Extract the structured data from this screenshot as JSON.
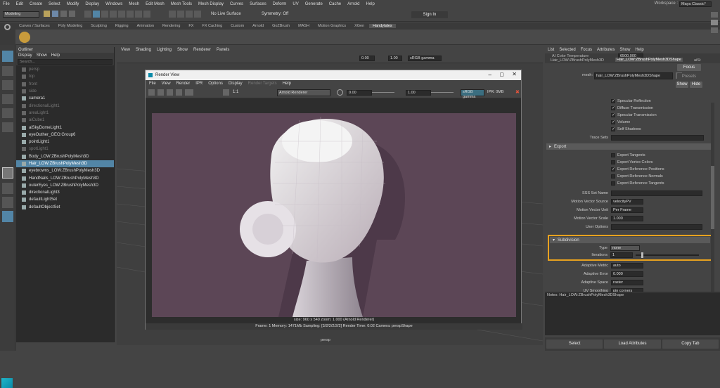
{
  "menubar": [
    "File",
    "Edit",
    "Create",
    "Select",
    "Modify",
    "Display",
    "Windows",
    "Mesh",
    "Edit Mesh",
    "Mesh Tools",
    "Mesh Display",
    "Curves",
    "Surfaces",
    "Deform",
    "UV",
    "Generate",
    "Cache",
    "Arnold",
    "Help"
  ],
  "workspace": {
    "label": "Workspace :",
    "value": "Maya Classic*"
  },
  "toolbar": {
    "mode": "Modeling",
    "live": "No Live Surface",
    "symmetry": "Symmetry: Off",
    "signin": "Sign In"
  },
  "shelf_tabs": [
    "Curves / Surfaces",
    "Poly Modeling",
    "Sculpting",
    "Rigging",
    "Animation",
    "Rendering",
    "FX",
    "FX Caching",
    "Custom",
    "Arnold",
    "GoZBrush",
    "MASH",
    "Motion Graphics",
    "XGen",
    "Handytales"
  ],
  "shelf_active": "Handytales",
  "outliner": {
    "title": "Outliner",
    "menu": [
      "Display",
      "Show",
      "Help"
    ],
    "search_placeholder": "Search...",
    "items": [
      {
        "label": "persp",
        "dim": true
      },
      {
        "label": "top",
        "dim": true
      },
      {
        "label": "front",
        "dim": true
      },
      {
        "label": "side",
        "dim": true
      },
      {
        "label": "camera1",
        "dim": false
      },
      {
        "label": "directionalLight1",
        "dim": true
      },
      {
        "label": "areaLight1",
        "dim": true
      },
      {
        "label": "aiCube1",
        "dim": true
      },
      {
        "label": "aiSkyDomeLight1",
        "dim": false
      },
      {
        "label": "eyeOuther_GEO:Group6",
        "dim": false
      },
      {
        "label": "pointLight1",
        "dim": false
      },
      {
        "label": "spotLight1",
        "dim": true
      },
      {
        "label": "Body_LOW:ZBrushPolyMesh3D",
        "dim": false
      },
      {
        "label": "Hair_LOW:ZBrushPolyMesh3D",
        "dim": false,
        "selected": true
      },
      {
        "label": "eyebrowns_LOW:ZBrushPolyMesh3D",
        "dim": false
      },
      {
        "label": "HandNails_LOW:ZBrushPolyMesh3D",
        "dim": false
      },
      {
        "label": "outerEyes_LOW:ZBrushPolyMesh3D",
        "dim": false
      },
      {
        "label": "directionalLight3",
        "dim": false
      },
      {
        "label": "defaultLightSet",
        "dim": false
      },
      {
        "label": "defaultObjectSet",
        "dim": false
      }
    ]
  },
  "viewport": {
    "menu": [
      "View",
      "Shading",
      "Lighting",
      "Show",
      "Renderer",
      "Panels"
    ],
    "exposure": "0.00",
    "gamma": "1.00",
    "colorspace": "sRGB gamma",
    "camera": "persp"
  },
  "render_view": {
    "title": "Render View",
    "menu": [
      "File",
      "View",
      "Render",
      "IPR",
      "Options",
      "Display",
      "Render Targets",
      "Help"
    ],
    "ratio": "1:1",
    "renderer": "Arnold Renderer",
    "exposure": "0.00",
    "gamma": "1.00",
    "colorspace": "sRGB gamma",
    "ipr": "IPR: 0MB",
    "info": "size: 960 x 540  zoom: 1.000      (Arnold Renderer)",
    "status": "Frame: 1     Memory: 1471Mb     Sampling: [3/2/2/2/2/2]     Render Time: 0:02     Camera: perspShape"
  },
  "attr": {
    "menu": [
      "List",
      "Selected",
      "Focus",
      "Attributes",
      "Show",
      "Help"
    ],
    "tab1": "AI Color Temperature",
    "tab1_val": "6500.000",
    "tab2": "Hair_LOW:ZBrushPolyMesh3D",
    "tab3": "Hair_LOW:ZBrushPolyMesh3DShape",
    "tab4": "aiSt",
    "mesh_label": "mesh:",
    "mesh_value": "hair_LOW:ZBrushPolyMesh3DShape",
    "focus": "Focus",
    "presets": "Presets",
    "show": "Show",
    "hide": "Hide",
    "checks_top": [
      "Specular Reflection",
      "Diffuse Transmission",
      "Specular Transmission",
      "Volume",
      "Self Shadows"
    ],
    "trace_sets": "Trace Sets",
    "export_section": "Export",
    "export_checks": [
      {
        "label": "Export Tangents",
        "on": false
      },
      {
        "label": "Export Vertex Colors",
        "on": false
      },
      {
        "label": "Export Reference Positions",
        "on": true
      },
      {
        "label": "Export Reference Normals",
        "on": false
      },
      {
        "label": "Export Reference Tangents",
        "on": false
      }
    ],
    "fields": [
      {
        "label": "SSS Set Name",
        "value": ""
      },
      {
        "label": "Motion Vector Source",
        "value": "velocityPV"
      },
      {
        "label": "Motion Vector Unit",
        "value": "Per Frame"
      },
      {
        "label": "Motion Vector Scale",
        "value": "1.000"
      },
      {
        "label": "User Options",
        "value": ""
      }
    ],
    "subdiv_section": "Subdivision",
    "subdiv_type_label": "Type",
    "subdiv_type": "none",
    "subdiv_iter_label": "Iterations",
    "subdiv_iter": "1",
    "more": [
      {
        "label": "Adaptive Metric",
        "value": "auto"
      },
      {
        "label": "Adaptive Error",
        "value": "0.000"
      },
      {
        "label": "Adaptive Space",
        "value": "raster"
      },
      {
        "label": "UV Smoothing",
        "value": "pin corners"
      }
    ],
    "notes": "Notes:  Hair_LOW:ZBrushPolyMesh3DShape",
    "btn_select": "Select",
    "btn_load": "Load Attributes",
    "btn_copy": "Copy Tab"
  },
  "colors": {
    "highlight": "#e8a21f",
    "render_bg": "#5c4656",
    "selected_row": "#5285a6"
  }
}
